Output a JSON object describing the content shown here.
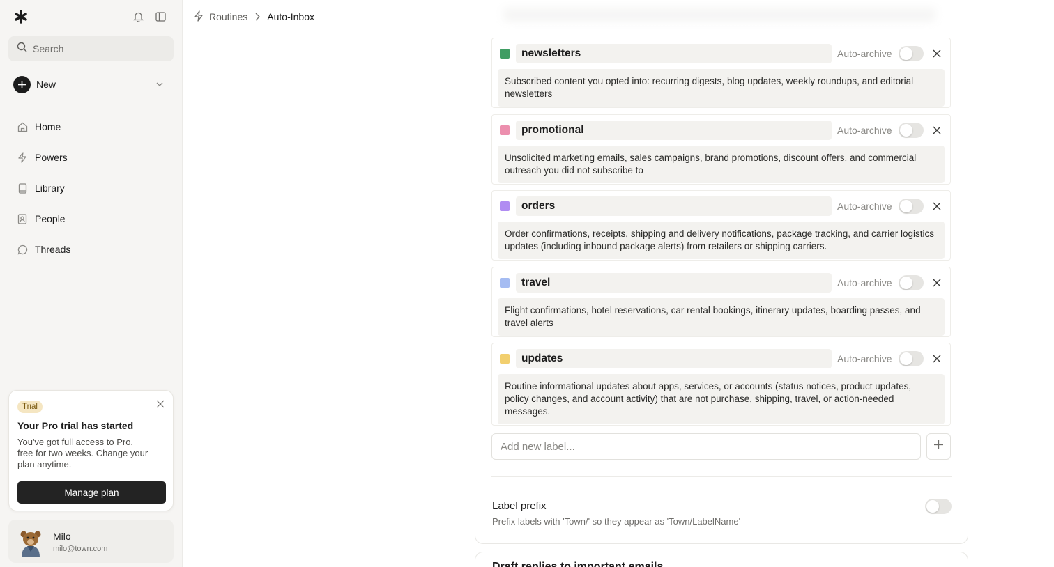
{
  "sidebar": {
    "search_placeholder": "Search",
    "new_label": "New",
    "nav": [
      {
        "label": "Home",
        "icon": "home-icon"
      },
      {
        "label": "Powers",
        "icon": "bolt-icon"
      },
      {
        "label": "Library",
        "icon": "book-icon"
      },
      {
        "label": "People",
        "icon": "contact-icon"
      },
      {
        "label": "Threads",
        "icon": "chat-icon"
      }
    ],
    "trial": {
      "badge": "Trial",
      "title": "Your Pro trial has started",
      "body": "You've got full access to Pro, free for two weeks. Change your plan anytime.",
      "button": "Manage plan"
    },
    "user": {
      "name": "Milo",
      "email": "milo@town.com"
    }
  },
  "breadcrumb": {
    "parent": "Routines",
    "current": "Auto-Inbox"
  },
  "labels": [
    {
      "name": "newsletters",
      "color": "#3f9d63",
      "auto_archive_label": "Auto-archive",
      "auto_archive": false,
      "description": "Subscribed content you opted into: recurring digests, blog updates, weekly roundups, and editorial newsletters"
    },
    {
      "name": "promotional",
      "color": "#ec8fae",
      "auto_archive_label": "Auto-archive",
      "auto_archive": false,
      "description": "Unsolicited marketing emails, sales campaigns, brand promotions, discount offers, and commercial outreach you did not subscribe to"
    },
    {
      "name": "orders",
      "color": "#b08cf2",
      "auto_archive_label": "Auto-archive",
      "auto_archive": false,
      "description": "Order confirmations, receipts, shipping and delivery notifications, package tracking, and carrier logistics updates (including inbound package alerts) from retailers or shipping carriers."
    },
    {
      "name": "travel",
      "color": "#a5bcf2",
      "auto_archive_label": "Auto-archive",
      "auto_archive": false,
      "description": "Flight confirmations, hotel reservations, car rental bookings, itinerary updates, boarding passes, and travel alerts"
    },
    {
      "name": "updates",
      "color": "#f2cf6e",
      "auto_archive_label": "Auto-archive",
      "auto_archive": false,
      "description": "Routine informational updates about apps, services, or accounts (status notices, product updates, policy changes, and account activity) that are not purchase, shipping, travel, or action-needed messages."
    }
  ],
  "add_label_placeholder": "Add new label...",
  "label_prefix": {
    "title": "Label prefix",
    "description": "Prefix labels with 'Town/' so they appear as 'Town/LabelName'",
    "enabled": false
  },
  "next_section_title": "Draft replies to important emails"
}
